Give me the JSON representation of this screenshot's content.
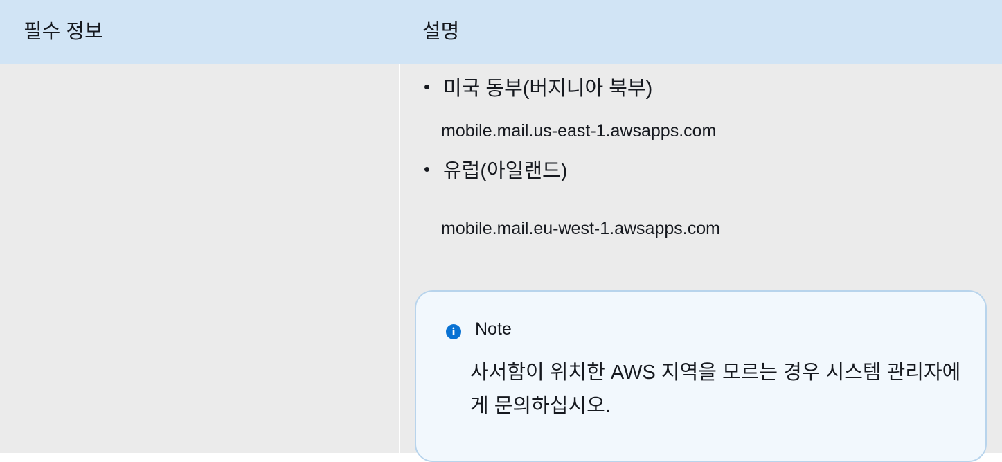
{
  "table": {
    "headers": [
      "필수 정보",
      "설명"
    ],
    "regions": [
      {
        "name": "미국 동부(버지니아 북부)",
        "endpoint": "mobile.mail.us-east-1.awsapps.com"
      },
      {
        "name": "유럽(아일랜드)",
        "endpoint": "mobile.mail.eu-west-1.awsapps.com"
      }
    ]
  },
  "note": {
    "icon": "info-icon",
    "icon_glyph": "i",
    "title": "Note",
    "text": "사서함이 위치한 AWS 지역을 모르는 경우 시스템 관리자에게 문의하십시오."
  },
  "colors": {
    "header_bg": "#d1e4f5",
    "body_bg": "#ebebeb",
    "note_bg": "#f2f8fd",
    "note_border": "#b8d4ec",
    "info_icon": "#0972d3"
  }
}
